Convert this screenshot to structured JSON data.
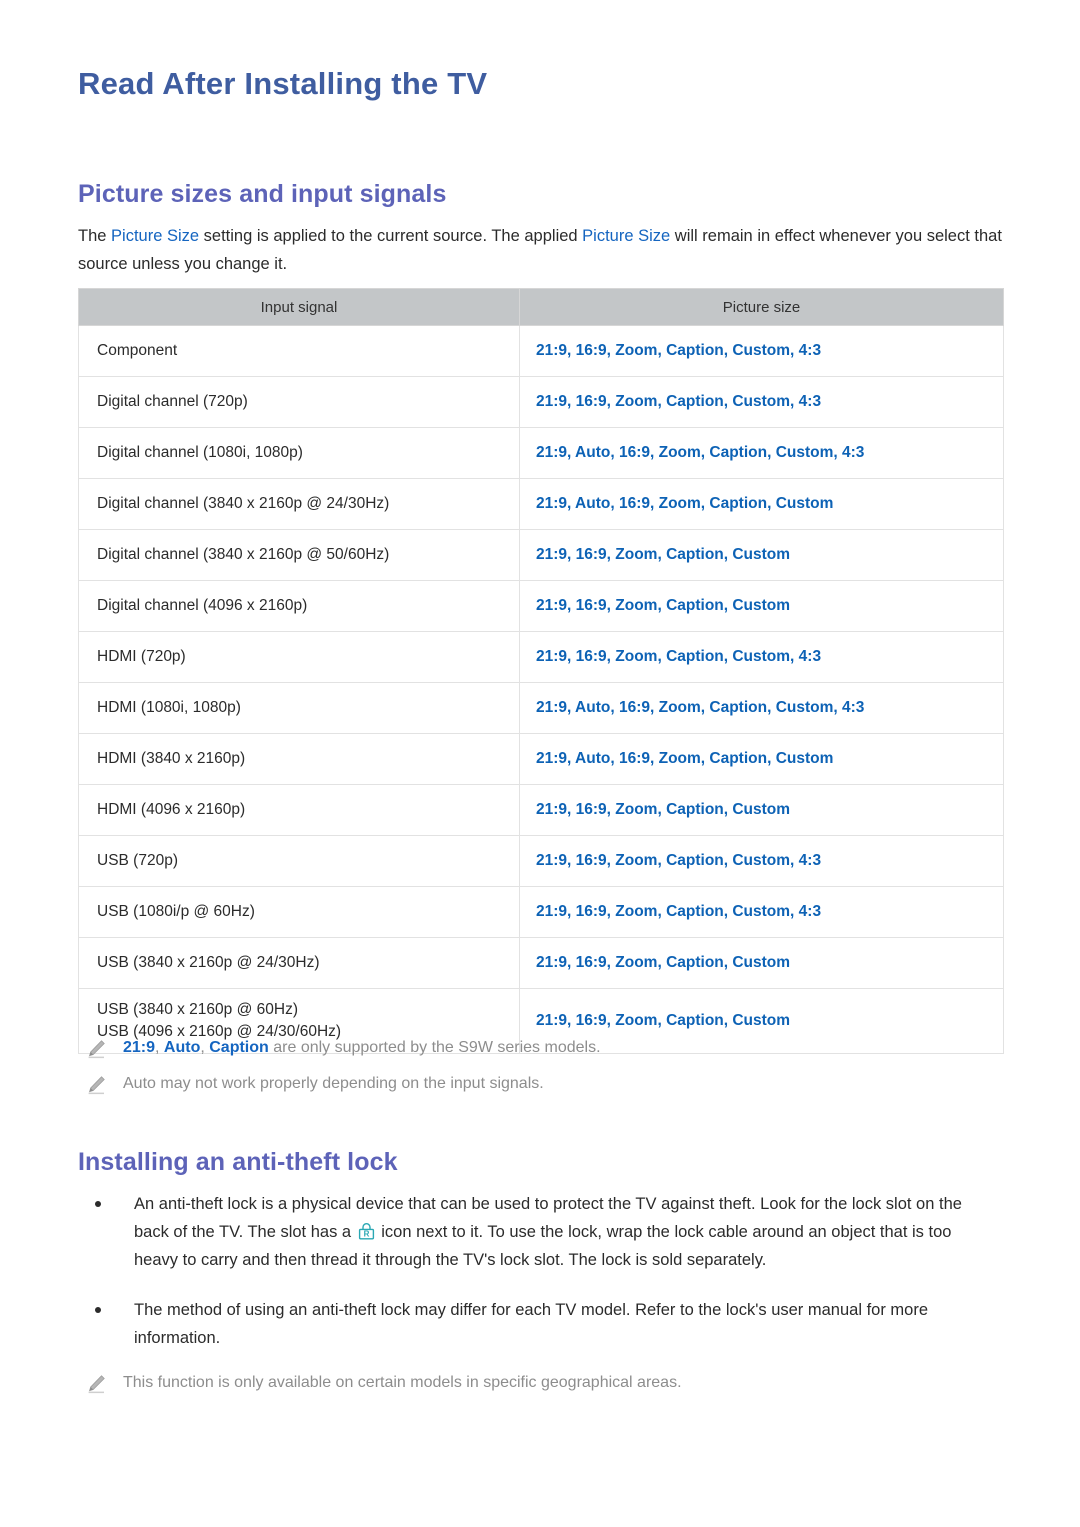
{
  "document": {
    "page_title": "Read After Installing the TV"
  },
  "sections": {
    "picture_sizes": {
      "heading": "Picture sizes and input signals",
      "intro": {
        "part1": "The ",
        "kw1": "Picture Size",
        "part2": " setting is applied to the current source. The applied ",
        "kw2": "Picture Size",
        "part3": " will remain in effect whenever you select that source unless you change it."
      },
      "table": {
        "headers": [
          "Input signal",
          "Picture size"
        ],
        "rows": [
          {
            "signal": "Component",
            "size": "21:9, 16:9, Zoom, Caption, Custom, 4:3"
          },
          {
            "signal": "Digital channel (720p)",
            "size": "21:9, 16:9, Zoom, Caption, Custom, 4:3"
          },
          {
            "signal": "Digital channel (1080i, 1080p)",
            "size": "21:9, Auto, 16:9, Zoom, Caption, Custom, 4:3"
          },
          {
            "signal": "Digital channel (3840 x 2160p @ 24/30Hz)",
            "size": "21:9, Auto, 16:9, Zoom, Caption, Custom"
          },
          {
            "signal": "Digital channel (3840 x 2160p @ 50/60Hz)",
            "size": "21:9, 16:9, Zoom, Caption, Custom"
          },
          {
            "signal": "Digital channel (4096 x 2160p)",
            "size": "21:9, 16:9, Zoom, Caption, Custom"
          },
          {
            "signal": "HDMI (720p)",
            "size": "21:9, 16:9, Zoom, Caption, Custom, 4:3"
          },
          {
            "signal": "HDMI (1080i, 1080p)",
            "size": "21:9, Auto, 16:9, Zoom, Caption, Custom, 4:3"
          },
          {
            "signal": "HDMI (3840 x 2160p)",
            "size": "21:9, Auto, 16:9, Zoom, Caption, Custom"
          },
          {
            "signal": "HDMI (4096 x 2160p)",
            "size": "21:9, 16:9, Zoom, Caption, Custom"
          },
          {
            "signal": "USB (720p)",
            "size": "21:9, 16:9, Zoom, Caption, Custom, 4:3"
          },
          {
            "signal": "USB (1080i/p @ 60Hz)",
            "size": "21:9, 16:9, Zoom, Caption, Custom, 4:3"
          },
          {
            "signal": "USB (3840 x 2160p @ 24/30Hz)",
            "size": "21:9, 16:9, Zoom, Caption, Custom"
          },
          {
            "signal": "USB (3840 x 2160p @ 60Hz)",
            "signal_line2": "USB (4096 x 2160p @ 24/30/60Hz)",
            "size": "21:9, 16:9, Zoom, Caption, Custom"
          }
        ]
      },
      "notes": [
        {
          "icon": "pencil-icon",
          "kw1": "21:9",
          "sep1": ", ",
          "kw2": "Auto",
          "sep2": ", ",
          "kw3": "Caption",
          "tail": " are only supported by the S9W series models."
        },
        {
          "icon": "pencil-icon",
          "text": "Auto may not work properly depending on the input signals."
        }
      ]
    },
    "anti_theft": {
      "heading": "Installing an anti-theft lock",
      "bullets": [
        {
          "part1": "An anti-theft lock is a physical device that can be used to protect the TV against theft. Look for the lock slot on the back of the TV. The slot has a ",
          "icon": "kensington-lock-icon",
          "part2": " icon next to it. To use the lock, wrap the lock cable around an object that is too heavy to carry and then thread it through the TV's lock slot. The lock is sold separately."
        },
        {
          "text": "The method of using an anti-theft lock may differ for each TV model. Refer to the lock's user manual for more information."
        }
      ],
      "notes": [
        {
          "icon": "pencil-icon",
          "text": "This function is only available on certain models in specific geographical areas."
        }
      ]
    }
  },
  "colors": {
    "page_title": "#3f5da0",
    "section_title": "#5d63b8",
    "keyword_blue": "#1565c0",
    "table_value_blue": "#0d62b5",
    "table_header_bg": "#c3c6c8",
    "note_gray": "#8d8d8d",
    "lock_icon_teal": "#2aa8b4"
  }
}
